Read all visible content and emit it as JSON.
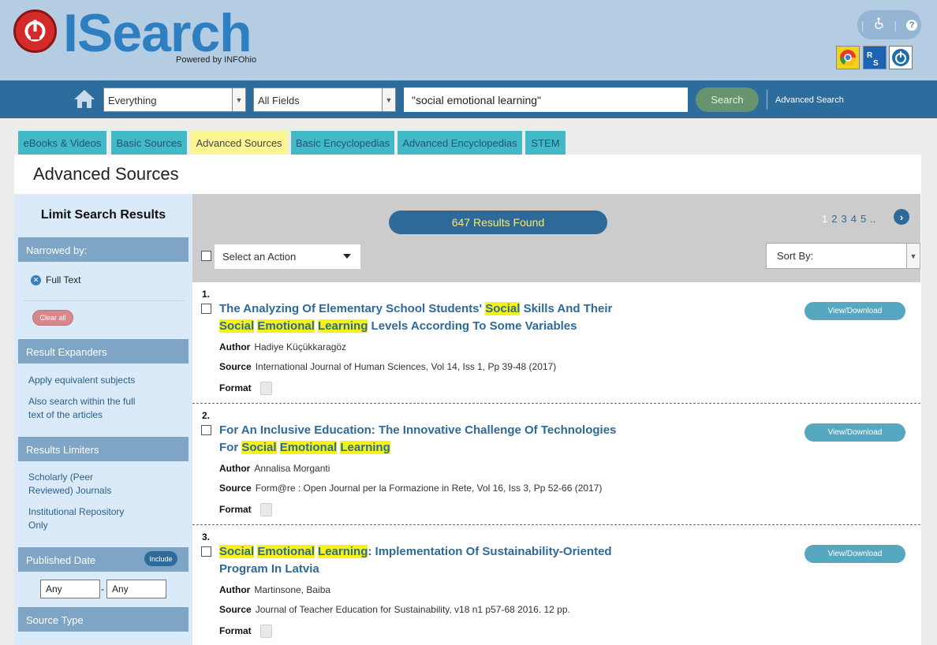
{
  "header": {
    "logo_text": "ISearch",
    "logo_sub": "Powered by INFOhio",
    "help_label": "?"
  },
  "searchbar": {
    "source_select": "Everything",
    "field_select": "All Fields",
    "query": "\"social emotional learning\"",
    "search_label": "Search",
    "advanced_label": "Advanced Search"
  },
  "tabs": [
    {
      "label": "eBooks & Videos"
    },
    {
      "label": "Basic Sources"
    },
    {
      "label": "Advanced Sources"
    },
    {
      "label": "Basic Encyclopedias"
    },
    {
      "label": "Advanced Encyclopedias"
    },
    {
      "label": "STEM"
    }
  ],
  "panel_title": "Advanced Sources",
  "sidebar": {
    "title": "Limit Search Results",
    "narrowed_by": "Narrowed by:",
    "full_text": "Full Text",
    "clear_all": "Clear all",
    "expanders_head": "Result Expanders",
    "expander_1": "Apply equivalent subjects",
    "expander_2": "Also search within the full text of the articles",
    "limiters_head": "Results Limiters",
    "limiter_1": "Scholarly (Peer Reviewed) Journals",
    "limiter_2": "Institutional Repository Only",
    "date_head": "Published Date",
    "include_label": "Include",
    "date_from": "Any",
    "date_dash": "-",
    "date_to": "Any",
    "source_type_head": "Source Type"
  },
  "results_bar": {
    "count_text": "647 Results Found",
    "pages": [
      "1",
      "2",
      "3",
      "4",
      "5",
      ".."
    ],
    "action_placeholder": "Select an Action",
    "sort_label": "Sort By:"
  },
  "labels": {
    "author": "Author",
    "source": "Source",
    "format": "Format",
    "view": "View/Download"
  },
  "results": [
    {
      "num": "1.",
      "title_1a": "The Analyzing Of Elementary School Students' ",
      "title_1b": "Social",
      "title_1c": " Skills And Their",
      "title_2a": "Social",
      "title_2b": "Emotional",
      "title_2c": "Learning",
      "title_2d": " Levels According To Some Variables",
      "author": "Hadiye Küçükkaragöz",
      "source": "International Journal of Human Sciences, Vol 14, Iss 1, Pp 39-48 (2017)"
    },
    {
      "num": "2.",
      "title_1": "For An Inclusive Education: The Innovative Challenge Of Technologies",
      "title_2a": "For ",
      "title_2b": "Social",
      "title_2c": "Emotional",
      "title_2d": "Learning",
      "author": "Annalisa Morganti",
      "source": "Form@re : Open Journal per la Formazione in Rete, Vol 16, Iss 3, Pp 52-66 (2017)"
    },
    {
      "num": "3.",
      "title_1a": "Social",
      "title_1b": "Emotional",
      "title_1c": "Learning",
      "title_1d": ": Implementation Of Sustainability-Oriented",
      "title_2": "Program In Latvia",
      "author": "Martinsone, Baiba",
      "source": "Journal of Teacher Education for Sustainability, v18 n1 p57-68 2016. 12 pp."
    }
  ],
  "colors": {
    "header_bg": "#b4cde2",
    "nav_bg": "#2d6d9d",
    "tab_bg": "#43b8c6",
    "tab_active": "#fbf594",
    "highlight": "#f6f215",
    "link": "#2d6a9a"
  }
}
